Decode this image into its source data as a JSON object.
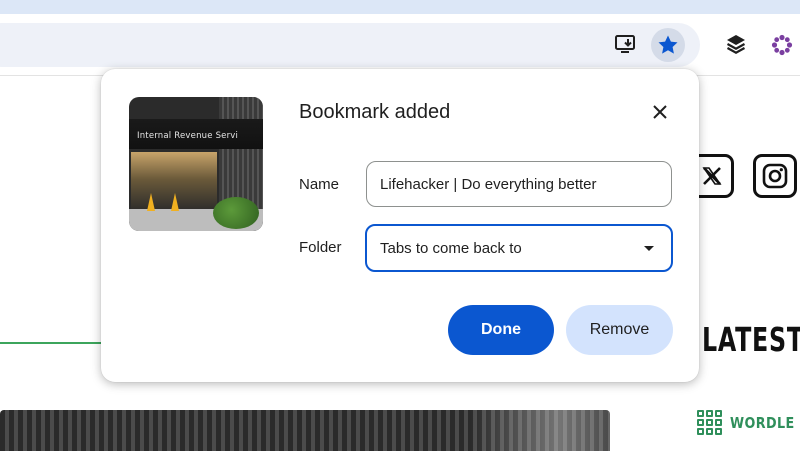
{
  "browser": {
    "toolbar": {
      "icons": [
        "install-app-icon",
        "bookmark-star-icon",
        "layers-extension-icon",
        "flower-extension-icon"
      ],
      "star_active_color": "#0b57d0"
    }
  },
  "page": {
    "latest_heading": "LATEST",
    "wordle_label": "WORDLE",
    "social_icons": [
      "x-logo-icon",
      "instagram-icon"
    ],
    "accent_green": "#2f8f5b"
  },
  "dialog": {
    "title": "Bookmark added",
    "thumbnail_sign_text": "Internal Revenue Servi",
    "name_label": "Name",
    "name_value": "Lifehacker | Do everything better",
    "folder_label": "Folder",
    "folder_value": "Tabs to come back to",
    "done_label": "Done",
    "remove_label": "Remove",
    "primary_color": "#0b57d0",
    "secondary_color": "#d3e3fd"
  }
}
